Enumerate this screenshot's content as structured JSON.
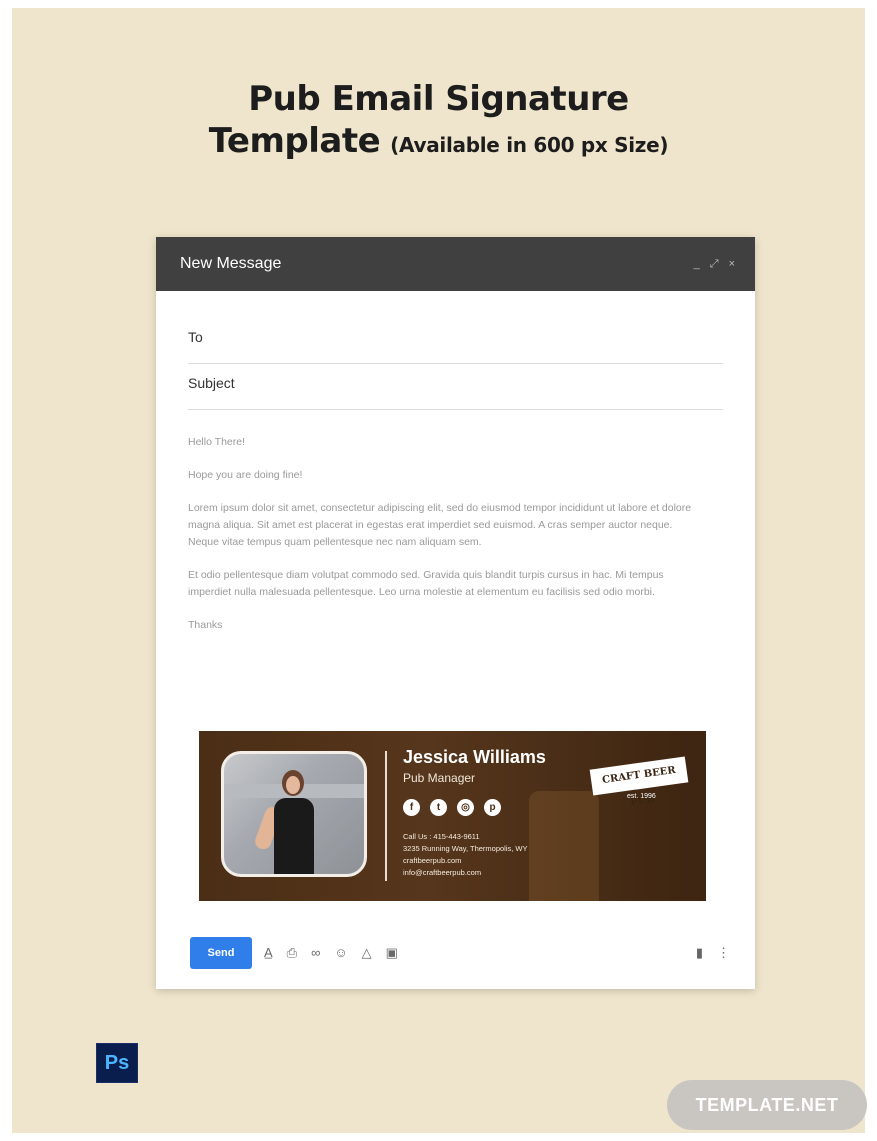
{
  "heading": {
    "line1": "Pub Email Signature",
    "line2": "Template",
    "availability": "(Available in 600 px Size)"
  },
  "window": {
    "title": "New Message",
    "controls": {
      "minimize": "_",
      "expand": "⤢",
      "close": "×"
    },
    "to_label": "To",
    "subject_label": "Subject"
  },
  "message": {
    "greeting": "Hello There!",
    "line2": "Hope you are doing fine!",
    "para1": "Lorem ipsum dolor sit amet, consectetur adipiscing elit, sed do eiusmod tempor incididunt ut labore et dolore magna aliqua. Sit amet est placerat in egestas erat imperdiet sed euismod. A cras semper auctor neque. Neque vitae tempus quam pellentesque nec nam aliquam sem.",
    "para2": " Et odio pellentesque diam volutpat commodo sed. Gravida quis blandit turpis cursus in hac. Mi tempus imperdiet nulla malesuada pellentesque. Leo urna molestie at elementum eu facilisis sed odio morbi.",
    "closing": "Thanks"
  },
  "signature": {
    "name": "Jessica Williams",
    "role": "Pub Manager",
    "socials": [
      "facebook-icon",
      "twitter-icon",
      "instagram-icon",
      "pinterest-icon"
    ],
    "contact": {
      "phone": "Call Us : 415-443-9611",
      "address": "3235 Running Way, Thermopolis, WY",
      "website": "craftbeerpub.com",
      "email": "info@craftbeerpub.com"
    },
    "badge": "CRAFT BEER PUB",
    "est": "est. 1996"
  },
  "toolbar": {
    "send_label": "Send",
    "icons": [
      "format-text-icon",
      "attach-icon",
      "link-icon",
      "emoji-icon",
      "drive-icon",
      "photo-icon"
    ],
    "right_icons": [
      "trash-icon",
      "more-options-icon"
    ]
  },
  "software_badge": "Ps",
  "brand": "TEMPLATE.NET",
  "colors": {
    "page_bg": "#efe5cc",
    "header_bg": "#404040",
    "send_button": "#2f7ee9",
    "signature_bg": "#4b2e16"
  }
}
